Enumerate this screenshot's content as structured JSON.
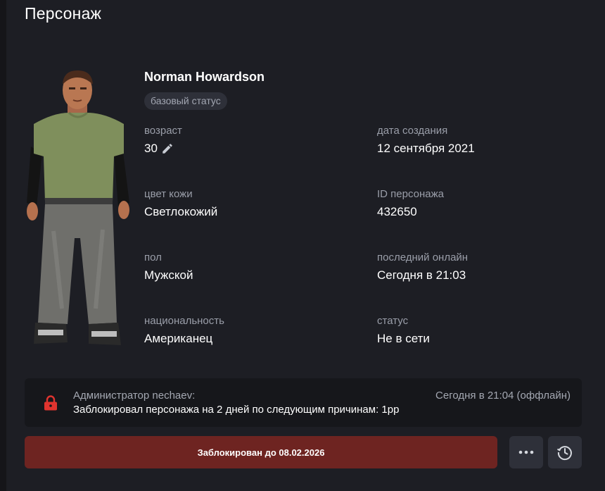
{
  "page": {
    "title": "Персонаж"
  },
  "character": {
    "name": "Norman Howardson",
    "status_badge": "базовый статус",
    "fields": {
      "age": {
        "label": "возраст",
        "value": "30"
      },
      "created": {
        "label": "дата создания",
        "value": "12 сентября 2021"
      },
      "skin": {
        "label": "цвет кожи",
        "value": "Светлокожий"
      },
      "id": {
        "label": "ID персонажа",
        "value": "432650"
      },
      "gender": {
        "label": "пол",
        "value": "Мужской"
      },
      "last_online": {
        "label": "последний онлайн",
        "value": "Сегодня в 21:03"
      },
      "nationality": {
        "label": "национальность",
        "value": "Американец"
      },
      "status": {
        "label": "статус",
        "value": "Не в сети"
      }
    }
  },
  "admin_notice": {
    "author": "Администратор nechaev:",
    "text": "Заблокировал персонажа на 2 дней по следующим причинам: 1рр",
    "time": "Сегодня в 21:04 (оффлайн)"
  },
  "actions": {
    "blocked_label": "Заблокирован до 08.02.2026",
    "more_icon": "more-dots-icon",
    "history_icon": "history-clock-icon"
  },
  "colors": {
    "background": "#1d1e24",
    "blocked_button": "#6e2421",
    "lock_icon": "#e0342f",
    "muted_text": "#9a9ea9"
  }
}
